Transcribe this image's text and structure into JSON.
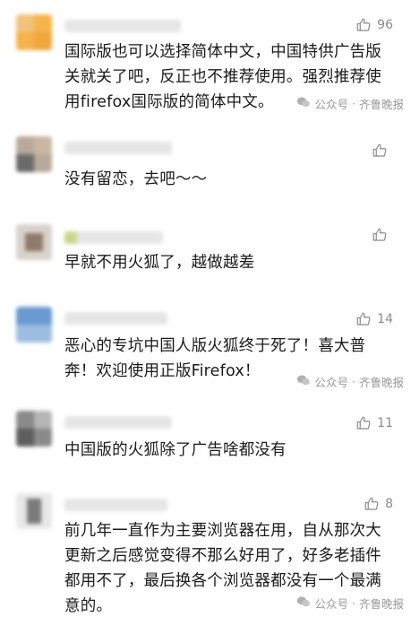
{
  "colors": {
    "text": "#1a1a1a",
    "meta": "#8a8a8a"
  },
  "watermark": {
    "source": "公众号",
    "separator": "·",
    "outlet": "齐鲁晚报"
  },
  "comments": [
    {
      "likes": "96",
      "text": "国际版也可以选择简体中文，中国特供广告版关就关了吧，反正也不推荐使用。强烈推荐使用firefox国际版的简体中文。",
      "has_watermark": true
    },
    {
      "likes": "",
      "text": "没有留恋，去吧～～",
      "has_watermark": false
    },
    {
      "likes": "",
      "text": "早就不用火狐了，越做越差",
      "has_watermark": false
    },
    {
      "likes": "14",
      "text": "恶心的专坑中国人版火狐终于死了！喜大普奔！欢迎使用正版Firefox！",
      "has_watermark": true
    },
    {
      "likes": "11",
      "text": "中国版的火狐除了广告啥都没有",
      "has_watermark": false
    },
    {
      "likes": "8",
      "text": "前几年一直作为主要浏览器在用，自从那次大更新之后感觉变得不那么好用了，好多老插件都用不了，最后换各个浏览器都没有一个最满意的。",
      "has_watermark": true
    }
  ]
}
